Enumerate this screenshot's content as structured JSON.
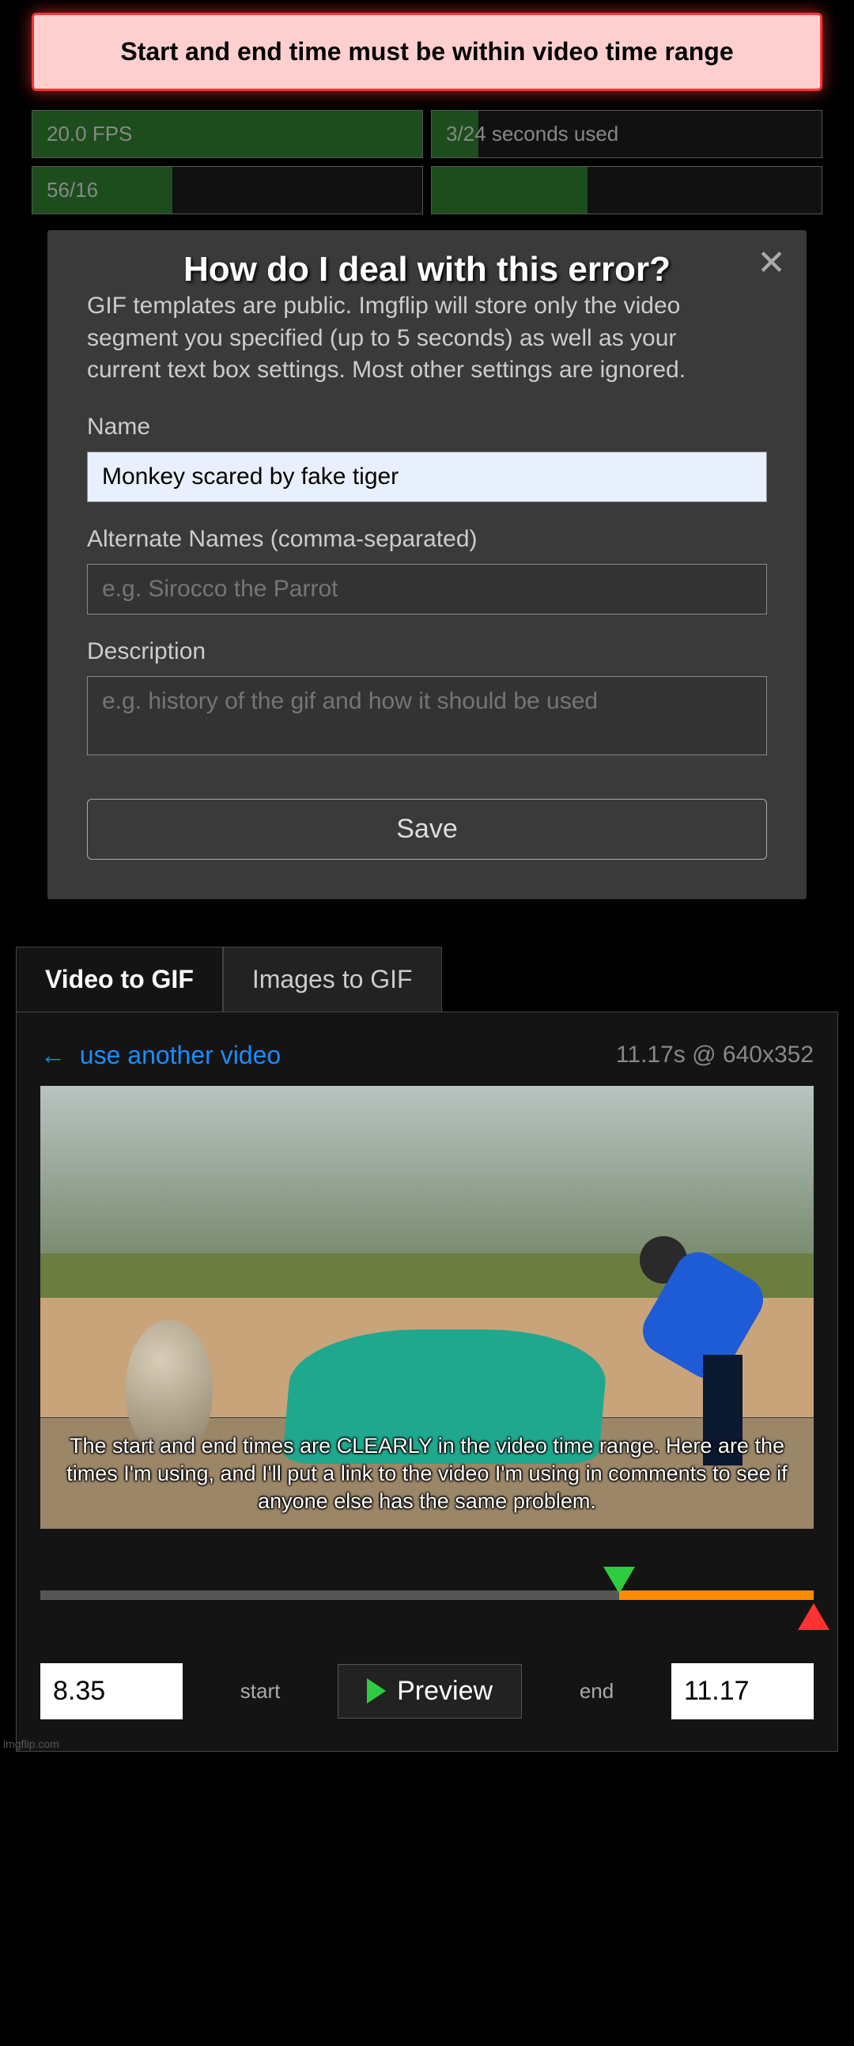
{
  "error_message": "Start and end time must be within video time range",
  "overlay_question": "How do I deal with this error?",
  "stats": {
    "fps": "20.0 FPS",
    "seconds_used": "3/24 seconds used",
    "frames_partial": "56/16",
    "other": ""
  },
  "modal": {
    "info_text": "GIF templates are public. Imgflip will store only the video segment you specified (up to 5 seconds) as well as your current text box settings. Most other settings are ignored.",
    "name_label": "Name",
    "name_value": "Monkey scared by fake tiger",
    "alt_label": "Alternate Names (comma-separated)",
    "alt_placeholder": "e.g. Sirocco the Parrot",
    "desc_label": "Description",
    "desc_placeholder": "e.g. history of the gif and how it should be used",
    "save_label": "Save"
  },
  "tabs": {
    "video": "Video to GIF",
    "images": "Images to GIF"
  },
  "editor": {
    "use_another": "use another video",
    "meta": "11.17s @ 640x352",
    "video_caption": "The start and end times are CLEARLY in the video time range. Here are the times I'm using, and I'll put a link to the video I'm using in comments to see if anyone else has the same problem.",
    "start_value": "8.35",
    "start_label": "start",
    "preview_label": "Preview",
    "end_label": "end",
    "end_value": "11.17",
    "timeline_start_pct": 74.8,
    "timeline_end_pct": 100
  },
  "watermark": "imgflip.com"
}
